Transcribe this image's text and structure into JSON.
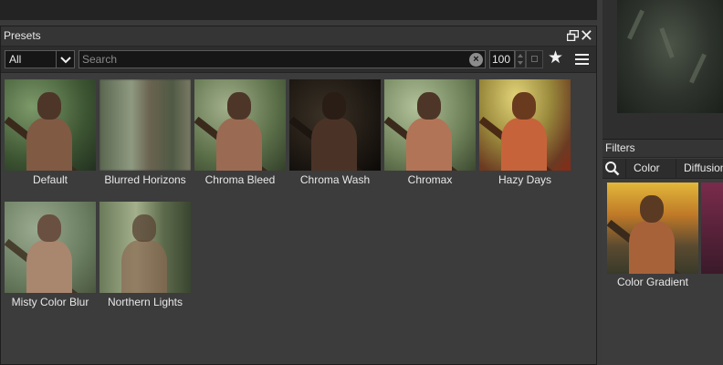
{
  "presets": {
    "title": "Presets",
    "category": "All",
    "search_placeholder": "Search",
    "zoom_value": "100",
    "items": [
      {
        "label": "Default"
      },
      {
        "label": "Blurred Horizons"
      },
      {
        "label": "Chroma Bleed"
      },
      {
        "label": "Chroma Wash"
      },
      {
        "label": "Chromax"
      },
      {
        "label": "Hazy Days"
      },
      {
        "label": "Misty Color Blur"
      },
      {
        "label": "Northern Lights"
      }
    ]
  },
  "filters": {
    "title": "Filters",
    "tabs": [
      {
        "label": "Color"
      },
      {
        "label": "Diffusion"
      }
    ],
    "items": [
      {
        "label": "Color Gradient"
      }
    ]
  },
  "colors": {
    "selection": "#39e61e",
    "panel": "#3c3c3c"
  }
}
